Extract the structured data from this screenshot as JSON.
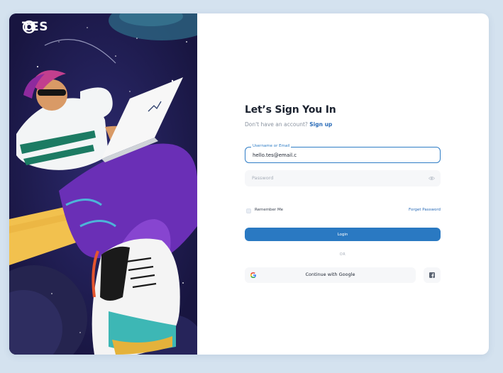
{
  "brand": {
    "logo_text": "TES"
  },
  "form": {
    "title": "Let’s Sign You In",
    "subtitle_prefix": "Don't have an account?",
    "signup_link": "Sign up",
    "username": {
      "label": "Username or Email",
      "value": "hello.tes@email.c"
    },
    "password": {
      "placeholder": "Password",
      "visibility_icon": "eye-icon"
    },
    "remember_label": "Remember Me",
    "remember_checked": false,
    "forgot_link": "Forget Password",
    "login_button": "Login",
    "divider_text": "OR",
    "google_button": "Continue with Google",
    "google_icon": "google-icon",
    "facebook_icon": "facebook-icon"
  },
  "colors": {
    "background": "#d4e2ef",
    "accent": "#2a79c2",
    "link": "#2b6cb8",
    "illustration_bg": "#1f1c4e"
  }
}
